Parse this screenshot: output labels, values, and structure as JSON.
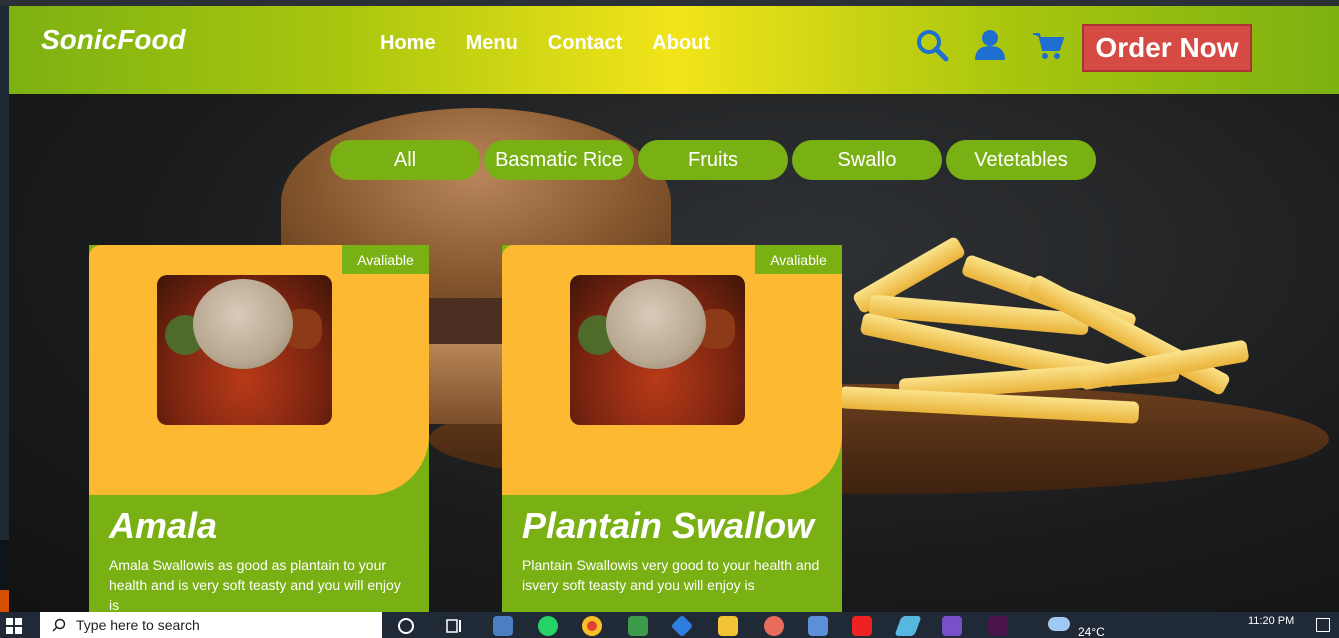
{
  "header": {
    "logo": "SonicFood",
    "nav": [
      "Home",
      "Menu",
      "Contact",
      "About"
    ],
    "order_label": "Order Now",
    "icons": [
      "search-icon",
      "user-icon",
      "cart-icon"
    ]
  },
  "categories": [
    "All",
    "Basmatic Rice",
    "Fruits",
    "Swallo",
    "Vetetables"
  ],
  "cards": [
    {
      "badge": "Avaliable",
      "title": "Amala",
      "desc": "Amala Swallowis as good as plantain to your health and is very soft teasty and you will enjoy is"
    },
    {
      "badge": "Avaliable",
      "title": "Plantain Swallow",
      "desc": "Plantain Swallowis very good to your health and isvery soft teasty and you will enjoy is"
    }
  ],
  "taskbar": {
    "search_placeholder": "Type here to search",
    "weather": "24°C",
    "time": "11:20 PM"
  },
  "colors": {
    "green": "#79b014",
    "yellow": "#f2e41a",
    "card_yellow": "#fdb931",
    "order_red": "#d64a44",
    "icon_blue": "#1f6fd1"
  }
}
